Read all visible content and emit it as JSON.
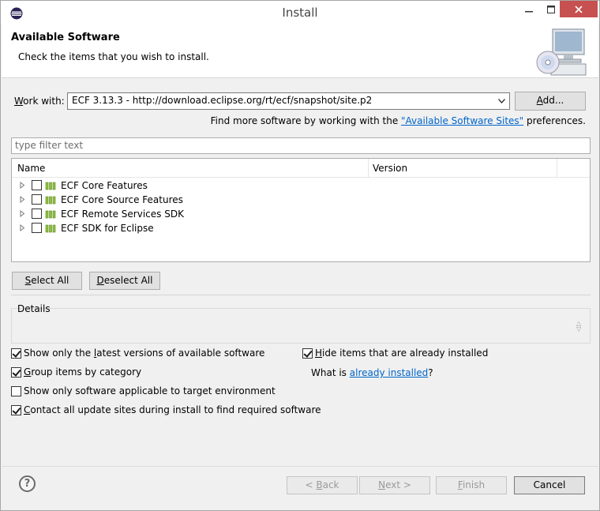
{
  "window": {
    "title": "Install",
    "controls": {
      "minimize": "—",
      "maximize": "□",
      "close": "✕"
    }
  },
  "header": {
    "title": "Available Software",
    "description": "Check the items that you wish to install.",
    "image_icon": "install-banner-icon"
  },
  "workwith": {
    "label_prefix": "",
    "label_mnemonic": "W",
    "label_rest": "ork with:",
    "value": "ECF 3.13.3 - http://download.eclipse.org/rt/ecf/snapshot/site.p2",
    "add_prefix": "",
    "add_mnemonic": "A",
    "add_rest": "dd...",
    "find_more_prefix": "Find more software by working with the ",
    "find_more_link": "\"Available Software Sites\"",
    "find_more_suffix": " preferences."
  },
  "filter": {
    "placeholder": "type filter text"
  },
  "tree": {
    "columns": {
      "name": "Name",
      "version": "Version"
    },
    "items": [
      {
        "label": "ECF Core Features",
        "checked": false
      },
      {
        "label": "ECF Core Source Features",
        "checked": false
      },
      {
        "label": "ECF Remote Services SDK",
        "checked": false
      },
      {
        "label": "ECF SDK for Eclipse",
        "checked": false
      }
    ]
  },
  "buttons": {
    "select_all_mnemonic": "S",
    "select_all_rest": "elect All",
    "deselect_all_mnemonic": "D",
    "deselect_all_rest": "eselect All",
    "back": "< ",
    "back_mnemonic": "B",
    "back_rest": "ack",
    "next_mnemonic": "N",
    "next_rest": "ext >",
    "finish_mnemonic": "F",
    "finish_rest": "inish",
    "cancel": "Cancel",
    "help": "?"
  },
  "details": {
    "label": "Details"
  },
  "options": {
    "show_latest": {
      "prefix": "Show only the ",
      "mnemonic": "l",
      "rest": "atest versions of available software",
      "checked": true
    },
    "hide_installed": {
      "prefix": "",
      "mnemonic": "H",
      "rest": "ide items that are already installed",
      "checked": true
    },
    "group_by_category": {
      "prefix": "",
      "mnemonic": "G",
      "rest": "roup items by category",
      "checked": true
    },
    "show_applicable": {
      "prefix": "Show only software applicable to target environment",
      "mnemonic": "",
      "rest": "",
      "checked": false
    },
    "contact_sites": {
      "prefix": "",
      "mnemonic": "C",
      "rest": "ontact all update sites during install to find required software",
      "checked": true
    }
  },
  "whatis": {
    "prefix": "What is ",
    "link": "already installed",
    "suffix": "?"
  },
  "colors": {
    "accent_link": "#0066cc",
    "close_button": "#c75050",
    "background": "#f0f0f0"
  }
}
